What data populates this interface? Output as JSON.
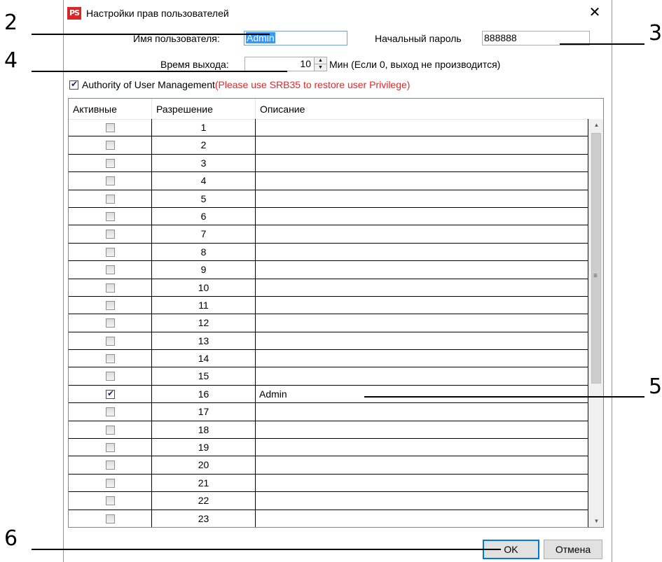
{
  "dialog": {
    "app_icon_text": "PS",
    "title": "Настройки прав пользователей",
    "close_glyph": "✕"
  },
  "form": {
    "username_label": "Имя пользователя:",
    "username_value": "Admin",
    "initial_password_label": "Начальный пароль",
    "initial_password_value": "888888",
    "logout_time_label": "Время выхода:",
    "logout_time_value": "10",
    "logout_time_hint": "Мин (Если 0, выход не производится)",
    "authority_checked": true,
    "authority_label": "Authority of User Management",
    "authority_warning": "(Please use SRB35 to restore user Privilege)"
  },
  "grid": {
    "columns": [
      "Активные",
      "Разрешение",
      "Описание"
    ],
    "rows": [
      {
        "active": false,
        "permission": "1",
        "description": ""
      },
      {
        "active": false,
        "permission": "2",
        "description": ""
      },
      {
        "active": false,
        "permission": "3",
        "description": ""
      },
      {
        "active": false,
        "permission": "4",
        "description": ""
      },
      {
        "active": false,
        "permission": "5",
        "description": ""
      },
      {
        "active": false,
        "permission": "6",
        "description": ""
      },
      {
        "active": false,
        "permission": "7",
        "description": ""
      },
      {
        "active": false,
        "permission": "8",
        "description": ""
      },
      {
        "active": false,
        "permission": "9",
        "description": ""
      },
      {
        "active": false,
        "permission": "10",
        "description": ""
      },
      {
        "active": false,
        "permission": "11",
        "description": ""
      },
      {
        "active": false,
        "permission": "12",
        "description": ""
      },
      {
        "active": false,
        "permission": "13",
        "description": ""
      },
      {
        "active": false,
        "permission": "14",
        "description": ""
      },
      {
        "active": false,
        "permission": "15",
        "description": ""
      },
      {
        "active": true,
        "permission": "16",
        "description": "Admin"
      },
      {
        "active": false,
        "permission": "17",
        "description": ""
      },
      {
        "active": false,
        "permission": "18",
        "description": ""
      },
      {
        "active": false,
        "permission": "19",
        "description": ""
      },
      {
        "active": false,
        "permission": "20",
        "description": ""
      },
      {
        "active": false,
        "permission": "21",
        "description": ""
      },
      {
        "active": false,
        "permission": "22",
        "description": ""
      },
      {
        "active": false,
        "permission": "23",
        "description": ""
      }
    ]
  },
  "buttons": {
    "ok": "OK",
    "cancel": "Отмена"
  },
  "callouts": {
    "c2": "2",
    "c3": "3",
    "c4": "4",
    "c5": "5",
    "c6": "6"
  },
  "colors": {
    "warning": "#ee2222",
    "selection": "#3399ff",
    "focus_border": "#0078d7",
    "app_icon": "#d9262b"
  }
}
